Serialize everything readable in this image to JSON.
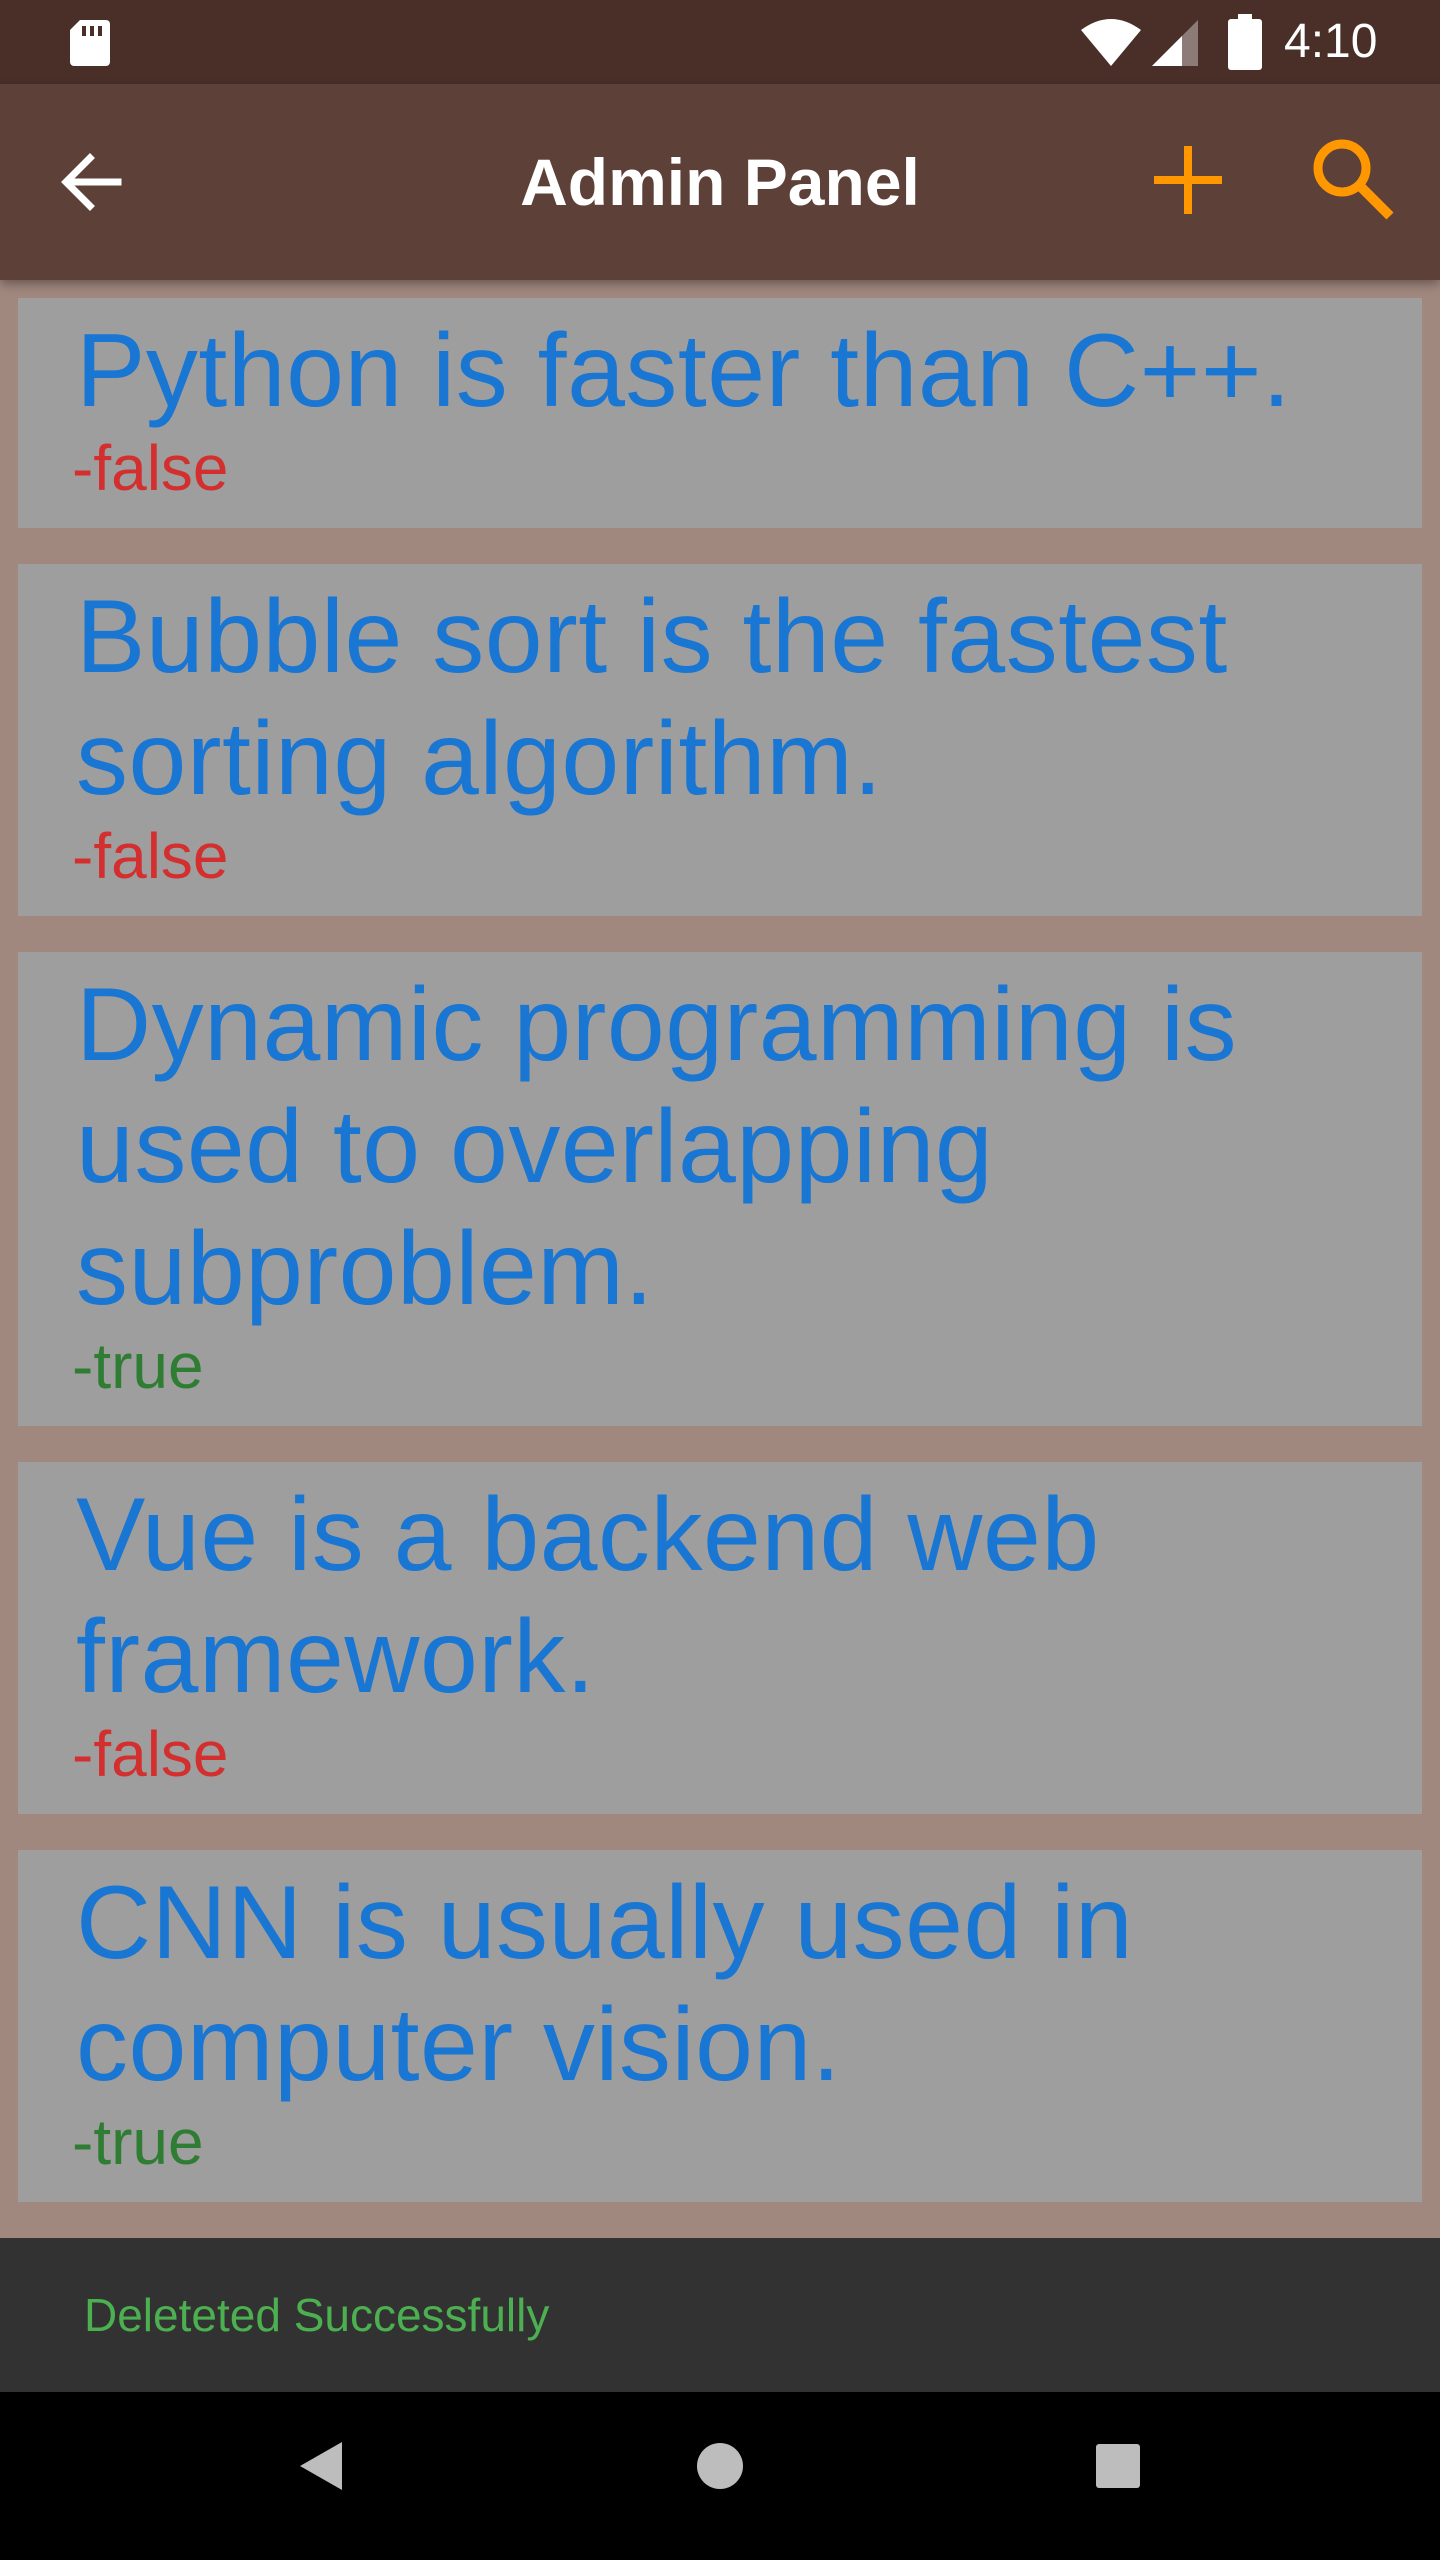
{
  "status_bar": {
    "time": "4:10",
    "icons": [
      "sd-card-icon",
      "wifi-icon",
      "cell-signal-icon",
      "battery-icon"
    ]
  },
  "app_bar": {
    "title": "Admin Panel",
    "back_icon": "arrow-back-icon",
    "add_icon": "plus-icon",
    "search_icon": "search-icon",
    "action_color": "#ff9800"
  },
  "questions": [
    {
      "text": "Python is faster than C++.",
      "answer": "-false"
    },
    {
      "text": "Bubble sort is the fastest sorting algorithm.",
      "answer": "-false"
    },
    {
      "text": "Dynamic programming is used to overlapping subproblem.",
      "answer": "-true"
    },
    {
      "text": "Vue is a backend web framework.",
      "answer": "-false"
    },
    {
      "text": "CNN is usually used in computer vision.",
      "answer": "-true"
    }
  ],
  "snackbar": {
    "message": "Deleteted Successfully"
  },
  "colors": {
    "question_text": "#1976d2",
    "false_answer": "#d32f2f",
    "true_answer": "#2e7d32",
    "app_bar": "#5d4037",
    "list_background": "#a1887f",
    "card_background": "#9e9e9e"
  }
}
